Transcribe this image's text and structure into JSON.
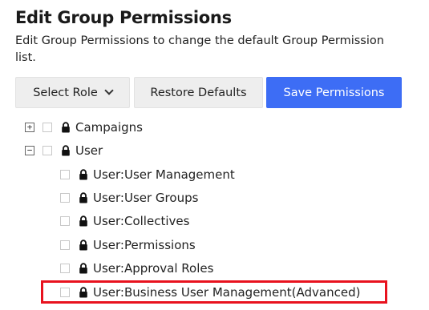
{
  "header": {
    "title": "Edit Group Permissions",
    "description_line1": "Edit Group Permissions to change the default Group Permission",
    "description_line2": "list."
  },
  "toolbar": {
    "select_role_label": "Select Role",
    "restore_label": "Restore Defaults",
    "save_label": "Save Permissions"
  },
  "tree": {
    "campaigns": {
      "label": "Campaigns",
      "toggle": "+",
      "expanded": false
    },
    "user": {
      "label": "User",
      "toggle": "−",
      "expanded": true
    },
    "children": [
      {
        "label": "User:User Management"
      },
      {
        "label": "User:User Groups"
      },
      {
        "label": "User:Collectives"
      },
      {
        "label": "User:Permissions"
      },
      {
        "label": "User:Approval Roles"
      },
      {
        "label": "User:Business User Management(Advanced)",
        "highlighted": true
      }
    ]
  },
  "colors": {
    "primary": "#3d6df5",
    "highlight_border": "#e8121e",
    "button_bg": "#eeeeee"
  },
  "icons": [
    "lock-icon",
    "chevron-down-icon",
    "expand-icon",
    "collapse-icon"
  ]
}
